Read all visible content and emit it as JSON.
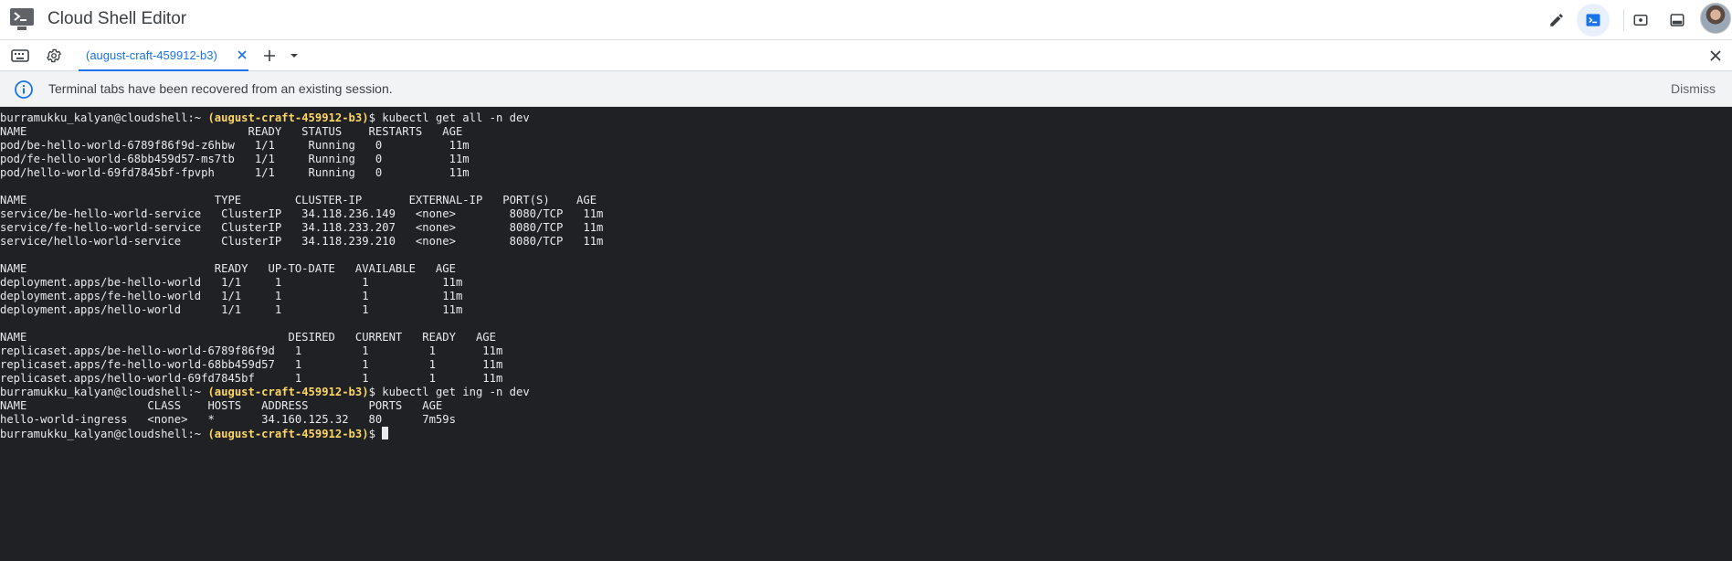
{
  "app": {
    "title": "Cloud Shell Editor"
  },
  "toolbar": {
    "icons": [
      "edit-icon",
      "terminal-icon",
      "preview-icon",
      "layout-icon",
      "more-vert-icon",
      "avatar"
    ]
  },
  "tabs": {
    "items": [
      {
        "label": "(august-craft-459912-b3)",
        "active": true
      }
    ]
  },
  "banner": {
    "message": "Terminal tabs have been recovered from an existing session.",
    "dismiss_label": "Dismiss"
  },
  "terminal": {
    "lines": [
      {
        "type": "prompt",
        "user": "burramukku_kalyan@cloudshell:~",
        "project": "(august-craft-459912-b3)",
        "cmd": "$ kubectl get all -n dev"
      },
      {
        "type": "out",
        "text": "NAME                                 READY   STATUS    RESTARTS   AGE"
      },
      {
        "type": "out",
        "text": "pod/be-hello-world-6789f86f9d-z6hbw   1/1     Running   0          11m"
      },
      {
        "type": "out",
        "text": "pod/fe-hello-world-68bb459d57-ms7tb   1/1     Running   0          11m"
      },
      {
        "type": "out",
        "text": "pod/hello-world-69fd7845bf-fpvph      1/1     Running   0          11m"
      },
      {
        "type": "out",
        "text": ""
      },
      {
        "type": "out",
        "text": "NAME                            TYPE        CLUSTER-IP       EXTERNAL-IP   PORT(S)    AGE"
      },
      {
        "type": "out",
        "text": "service/be-hello-world-service   ClusterIP   34.118.236.149   <none>        8080/TCP   11m"
      },
      {
        "type": "out",
        "text": "service/fe-hello-world-service   ClusterIP   34.118.233.207   <none>        8080/TCP   11m"
      },
      {
        "type": "out",
        "text": "service/hello-world-service      ClusterIP   34.118.239.210   <none>        8080/TCP   11m"
      },
      {
        "type": "out",
        "text": ""
      },
      {
        "type": "out",
        "text": "NAME                            READY   UP-TO-DATE   AVAILABLE   AGE"
      },
      {
        "type": "out",
        "text": "deployment.apps/be-hello-world   1/1     1            1           11m"
      },
      {
        "type": "out",
        "text": "deployment.apps/fe-hello-world   1/1     1            1           11m"
      },
      {
        "type": "out",
        "text": "deployment.apps/hello-world      1/1     1            1           11m"
      },
      {
        "type": "out",
        "text": ""
      },
      {
        "type": "out",
        "text": "NAME                                       DESIRED   CURRENT   READY   AGE"
      },
      {
        "type": "out",
        "text": "replicaset.apps/be-hello-world-6789f86f9d   1         1         1       11m"
      },
      {
        "type": "out",
        "text": "replicaset.apps/fe-hello-world-68bb459d57   1         1         1       11m"
      },
      {
        "type": "out",
        "text": "replicaset.apps/hello-world-69fd7845bf      1         1         1       11m"
      },
      {
        "type": "prompt",
        "user": "burramukku_kalyan@cloudshell:~",
        "project": "(august-craft-459912-b3)",
        "cmd": "$ kubectl get ing -n dev"
      },
      {
        "type": "out",
        "text": "NAME                  CLASS    HOSTS   ADDRESS         PORTS   AGE"
      },
      {
        "type": "out",
        "text": "hello-world-ingress   <none>   *       34.160.125.32   80      7m59s"
      },
      {
        "type": "prompt",
        "user": "burramukku_kalyan@cloudshell:~",
        "project": "(august-craft-459912-b3)",
        "cmd": "$ ",
        "cursor": true
      }
    ]
  },
  "colors": {
    "accent": "#1a73e8",
    "terminal_bg": "#202124",
    "terminal_fg": "#e8eaed",
    "prompt_project": "#fdd663",
    "banner_bg": "#f1f3f4"
  }
}
